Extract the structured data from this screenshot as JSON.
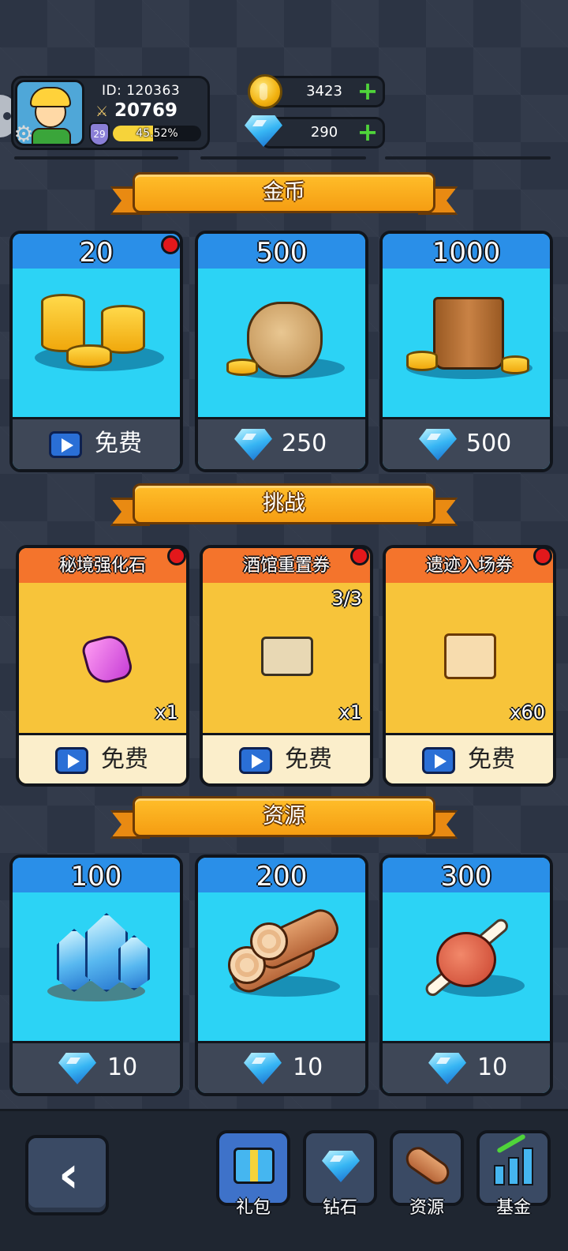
{
  "player": {
    "id_label": "ID: 120363",
    "power": "20769",
    "level": "29",
    "xp_text": "45.52%",
    "xp_fraction": 0.4552
  },
  "currency": {
    "gold": "3423",
    "diamonds": "290"
  },
  "sections": {
    "gold": {
      "title": "金币",
      "cards": [
        {
          "amount": "20",
          "cost": "免费",
          "cost_type": "video",
          "has_dot": true
        },
        {
          "amount": "500",
          "cost": "250",
          "cost_type": "diamond",
          "has_dot": false
        },
        {
          "amount": "1000",
          "cost": "500",
          "cost_type": "diamond",
          "has_dot": false
        }
      ]
    },
    "challenge": {
      "title": "挑战",
      "cards": [
        {
          "name": "秘境强化石",
          "quantity": "x1",
          "cost": "免费",
          "has_dot": true,
          "quota": ""
        },
        {
          "name": "酒馆重置券",
          "quantity": "x1",
          "cost": "免费",
          "has_dot": true,
          "quota": "3/3"
        },
        {
          "name": "遗迹入场券",
          "quantity": "x60",
          "cost": "免费",
          "has_dot": true,
          "quota": ""
        }
      ]
    },
    "resources": {
      "title": "资源",
      "cards": [
        {
          "amount": "100",
          "cost": "10",
          "cost_type": "diamond"
        },
        {
          "amount": "200",
          "cost": "10",
          "cost_type": "diamond"
        },
        {
          "amount": "300",
          "cost": "10",
          "cost_type": "diamond"
        }
      ]
    }
  },
  "nav": {
    "back_icon": "chevron-left-icon",
    "tabs": [
      {
        "label": "礼包",
        "icon": "gift-icon",
        "active": true
      },
      {
        "label": "钻石",
        "icon": "diamond-icon",
        "active": false
      },
      {
        "label": "资源",
        "icon": "log-icon",
        "active": false
      },
      {
        "label": "基金",
        "icon": "chart-icon",
        "active": false
      }
    ]
  },
  "colors": {
    "accent_orange": "#f59d12",
    "card_blue": "#2cd3f5",
    "card_yellow": "#f7c43a",
    "active_tab": "#3e72c9"
  }
}
